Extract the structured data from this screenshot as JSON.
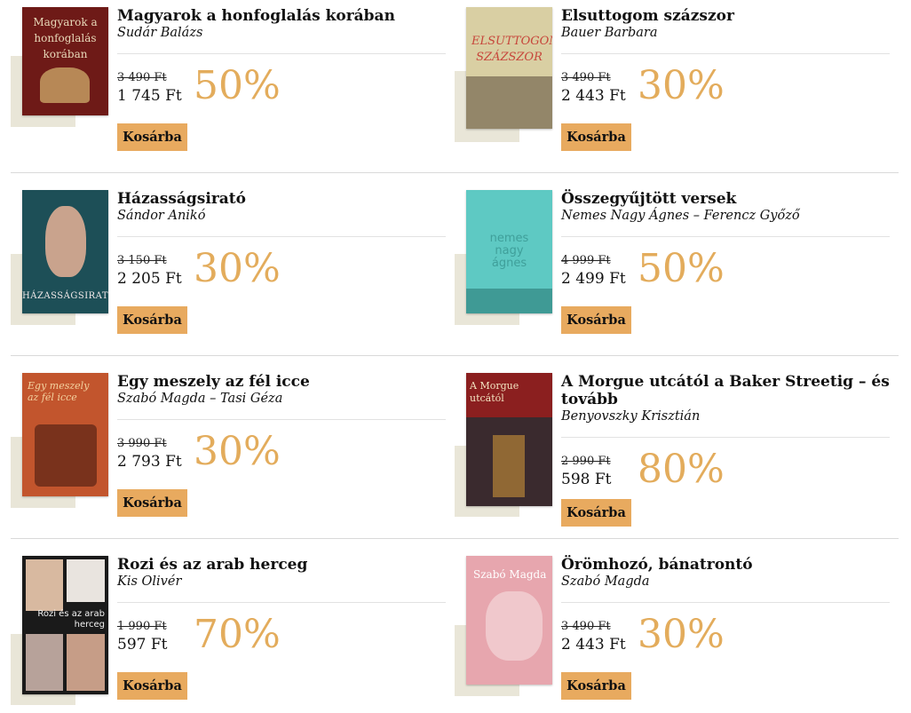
{
  "cart_label": "Kosárba",
  "books": [
    {
      "title": "Magyarok a honfoglalás korában",
      "author": "Sudár Balázs",
      "old_price": "3 490 Ft",
      "new_price": "1 745 Ft",
      "discount": "50%",
      "cover_color": "#6e1a17",
      "cover_text": "Magyarok a honfoglalás korában"
    },
    {
      "title": "Elsuttogom százszor",
      "author": "Bauer Barbara",
      "old_price": "3 490 Ft",
      "new_price": "2 443 Ft",
      "discount": "30%",
      "cover_color": "#d9cfa3",
      "cover_text": "ELSUTTOGOM SZÁZSZOR"
    },
    {
      "title": "Házasságsirató",
      "author": "Sándor Anikó",
      "old_price": "3 150 Ft",
      "new_price": "2 205 Ft",
      "discount": "30%",
      "cover_color": "#1d4f57",
      "cover_text": "HÁZASSÁGSIRATÓ"
    },
    {
      "title": "Összegyűjtött versek",
      "author": "Nemes Nagy Ágnes – Ferencz Győző",
      "old_price": "4 999 Ft",
      "new_price": "2 499 Ft",
      "discount": "50%",
      "cover_color": "#5ec9c3",
      "cover_text": "nemes nagy ágnes"
    },
    {
      "title": "Egy meszely az fél icce",
      "author": "Szabó Magda – Tasi Géza",
      "old_price": "3 990 Ft",
      "new_price": "2 793 Ft",
      "discount": "30%",
      "cover_color": "#c2552d",
      "cover_text": "Egy meszely az fél icce"
    },
    {
      "title": "A Morgue utcától a Baker Streetig – és tovább",
      "author": "Benyovszky Krisztián",
      "old_price": "2 990 Ft",
      "new_price": "598 Ft",
      "discount": "80%",
      "cover_color": "#3a2a2e",
      "cover_text": "A Morgue utcától"
    },
    {
      "title": "Rozi és az arab herceg",
      "author": "Kis Olivér",
      "old_price": "1 990 Ft",
      "new_price": "597 Ft",
      "discount": "70%",
      "cover_color": "#1a1a1a",
      "cover_text": "Rozi és az arab herceg"
    },
    {
      "title": "Örömhozó, bánatrontó",
      "author": "Szabó Magda",
      "old_price": "3 490 Ft",
      "new_price": "2 443 Ft",
      "discount": "30%",
      "cover_color": "#e7a6ae",
      "cover_text": "Szabó Magda"
    }
  ]
}
